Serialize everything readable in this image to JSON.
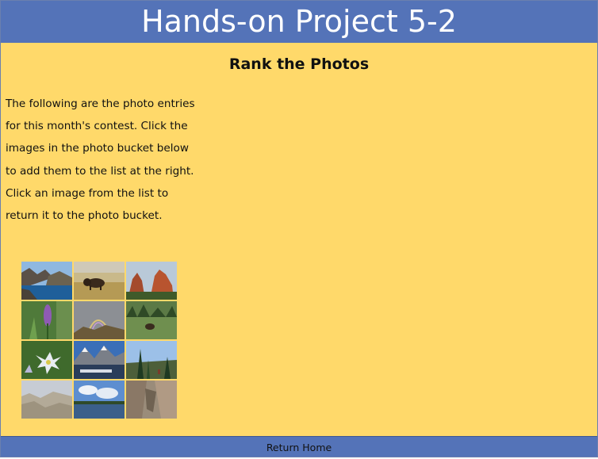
{
  "header": {
    "title": "Hands-on Project 5-2"
  },
  "main": {
    "heading": "Rank the Photos",
    "instructions": "The following are the photo entries for this month's contest. Click the images in the photo bucket below to add them to the list at the right. Click an image from the list to return it to the photo bucket."
  },
  "photo_bucket": {
    "photos": [
      {
        "subject": "mountain-lake-photo"
      },
      {
        "subject": "bison-photo"
      },
      {
        "subject": "red-rocks-photo"
      },
      {
        "subject": "purple-wildflower-photo"
      },
      {
        "subject": "rainbow-photo"
      },
      {
        "subject": "moose-meadow-photo"
      },
      {
        "subject": "white-flower-photo"
      },
      {
        "subject": "snowy-peaks-lake-photo"
      },
      {
        "subject": "pine-trail-photo"
      },
      {
        "subject": "badlands-photo"
      },
      {
        "subject": "cloudy-lake-photo"
      },
      {
        "subject": "rock-canyon-photo"
      }
    ]
  },
  "footer": {
    "link_label": "Return Home"
  },
  "colors": {
    "banner": "#5473b8",
    "background": "#ffd96a"
  }
}
